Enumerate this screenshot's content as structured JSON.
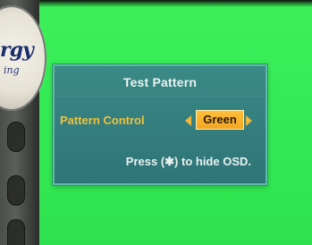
{
  "background": {
    "color": "#35ea55"
  },
  "bezel": {
    "logo_text": "rgy",
    "logo_sub": "ing"
  },
  "osd": {
    "title": "Test Pattern",
    "pattern_control": {
      "label": "Pattern Control",
      "value": "Green",
      "left_icon": "triangle-left",
      "right_icon": "triangle-right"
    },
    "hint": "Press (✱) to hide OSD.",
    "colors": {
      "panel": "#367f80",
      "label": "#f0c13a",
      "value_bg": "#f6ad2a",
      "text": "#e9f2ef"
    }
  }
}
